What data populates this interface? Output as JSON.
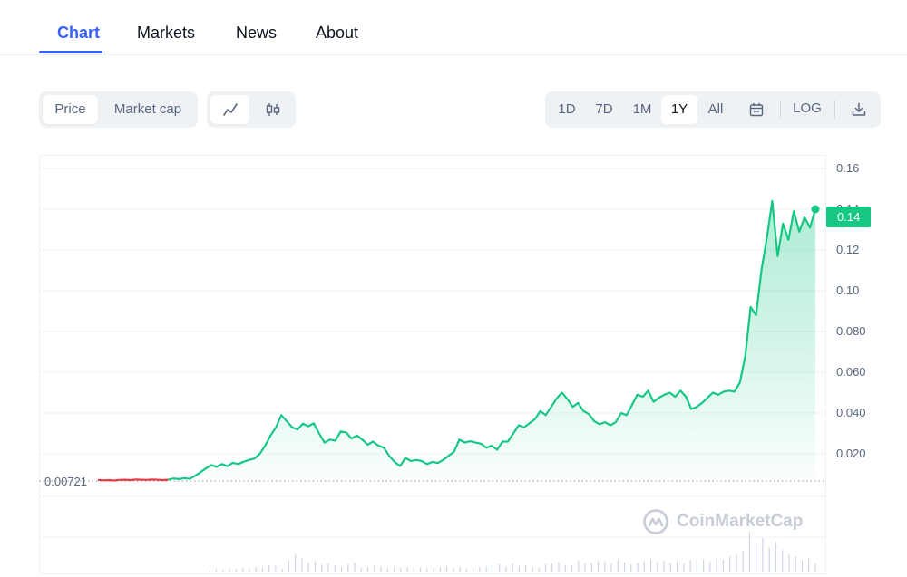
{
  "tabs": [
    {
      "label": "Chart",
      "active": true
    },
    {
      "label": "Markets"
    },
    {
      "label": "News"
    },
    {
      "label": "About"
    }
  ],
  "metric_toggle": {
    "price": "Price",
    "market_cap": "Market cap",
    "selected": "Price"
  },
  "chart_type_toggle": {
    "selected": "line-chart-icon",
    "icons": [
      "line-chart-icon",
      "candlestick-icon"
    ]
  },
  "ranges": {
    "items": [
      "1D",
      "7D",
      "1M",
      "1Y",
      "All"
    ],
    "selected": "1Y"
  },
  "toolbar": {
    "log_label": "LOG",
    "calendar_icon": "calendar-icon",
    "download_icon": "download-icon"
  },
  "colors": {
    "accent": "#3861fb",
    "up": "#16c784",
    "down": "#ea3943"
  },
  "watermark": "CoinMarketCap",
  "chart_data": {
    "type": "line",
    "y_ticks": [
      "0.020",
      "0.040",
      "0.060",
      "0.080",
      "0.10",
      "0.12",
      "0.14",
      "0.16"
    ],
    "current_price_label": "0.14",
    "start_price_label": "0.00721",
    "start_price": 0.00721,
    "ylim": [
      0,
      0.16
    ],
    "grid": true,
    "series": [
      {
        "values": [
          0.0072,
          0.007,
          0.0071,
          0.0069,
          0.0072,
          0.0073,
          0.0071,
          0.0074,
          0.0073,
          0.0072,
          0.0074,
          0.0073,
          0.0071,
          0.0073,
          0.0079,
          0.0076,
          0.0081,
          0.0077,
          0.0092,
          0.011,
          0.0128,
          0.0145,
          0.0136,
          0.015,
          0.0139,
          0.0156,
          0.015,
          0.0161,
          0.017,
          0.0177,
          0.02,
          0.024,
          0.029,
          0.033,
          0.039,
          0.036,
          0.033,
          0.032,
          0.0348,
          0.0335,
          0.035,
          0.03,
          0.0255,
          0.027,
          0.0265,
          0.031,
          0.0305,
          0.0275,
          0.029,
          0.027,
          0.0245,
          0.026,
          0.024,
          0.023,
          0.019,
          0.016,
          0.014,
          0.018,
          0.0165,
          0.017,
          0.0165,
          0.015,
          0.016,
          0.0155,
          0.017,
          0.019,
          0.021,
          0.027,
          0.0255,
          0.0262,
          0.0255,
          0.025,
          0.023,
          0.024,
          0.022,
          0.026,
          0.026,
          0.03,
          0.034,
          0.033,
          0.035,
          0.037,
          0.041,
          0.039,
          0.043,
          0.047,
          0.05,
          0.047,
          0.043,
          0.045,
          0.041,
          0.0395,
          0.036,
          0.0345,
          0.0355,
          0.034,
          0.0355,
          0.04,
          0.039,
          0.044,
          0.049,
          0.048,
          0.051,
          0.0455,
          0.0475,
          0.049,
          0.05,
          0.048,
          0.051,
          0.048,
          0.042,
          0.043,
          0.045,
          0.0475,
          0.05,
          0.049,
          0.0505,
          0.051,
          0.0505,
          0.055,
          0.068,
          0.092,
          0.088,
          0.11,
          0.126,
          0.144,
          0.117,
          0.133,
          0.125,
          0.139,
          0.129,
          0.136,
          0.131,
          0.14
        ],
        "color_down": "#ea3943",
        "color_up": "#16c784"
      }
    ],
    "volume_values": [
      0,
      0,
      0,
      0,
      0,
      0,
      0,
      0,
      0,
      0,
      0,
      0,
      0,
      0,
      0,
      0,
      0,
      0.05,
      0.08,
      0.07,
      0.1,
      0.09,
      0.12,
      0.1,
      0.14,
      0.12,
      0.18,
      0.16,
      0.1,
      0.3,
      0.45,
      0.35,
      0.25,
      0.28,
      0.2,
      0.22,
      0.18,
      0.15,
      0.2,
      0.25,
      0.12,
      0.14,
      0.18,
      0.15,
      0.1,
      0.12,
      0.11,
      0.13,
      0.09,
      0.12,
      0.1,
      0.11,
      0.13,
      0.15,
      0.12,
      0.14,
      0.1,
      0.12,
      0.13,
      0.15,
      0.18,
      0.2,
      0.15,
      0.22,
      0.16,
      0.18,
      0.14,
      0.12,
      0.2,
      0.22,
      0.25,
      0.19,
      0.18,
      0.3,
      0.22,
      0.24,
      0.28,
      0.26,
      0.22,
      0.3,
      0.25,
      0.2,
      0.24,
      0.28,
      0.32,
      0.26,
      0.3,
      0.24,
      0.28,
      0.22,
      0.3,
      0.35,
      0.32,
      0.28,
      0.35,
      0.32,
      0.4,
      0.45,
      0.55,
      1.0,
      0.7,
      0.85,
      0.6,
      0.75,
      0.55,
      0.45,
      0.4,
      0.3,
      0.35,
      0.22
    ]
  }
}
